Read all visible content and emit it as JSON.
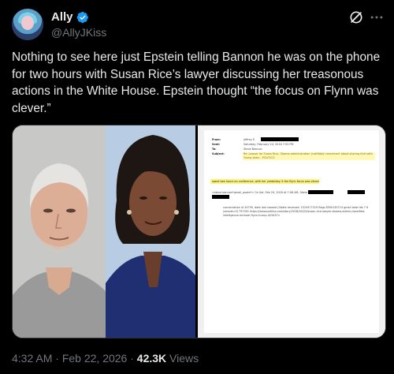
{
  "author": {
    "display_name": "Ally",
    "handle": "@AllyJKiss",
    "verified": true,
    "avatar_icon": "cartoon-avatar"
  },
  "header_icons": [
    "grok-icon",
    "more-options-icon"
  ],
  "tweet": {
    "text": "Nothing to see here just Epstein telling Bannon he was on the phone for two hours with Susan Rice’s lawyer discussing her treasonous actions in the White House. Epstein thought “the focus on Flynn was clever.”"
  },
  "media": {
    "images": [
      "photo-jeffrey-epstein",
      "photo-susan-rice",
      "email-document-screenshot"
    ],
    "document": {
      "from_label": "From:",
      "from_value": "jeffrey E.",
      "sent_label": "Sent:",
      "sent_value": "Saturday, February 24, 2018 7:53 PM",
      "to_label": "To:",
      "to_value": "Steve Bannon",
      "subject_label": "Subject:",
      "subject_value": "Re: Lawyer for Susan Rice, Obama administration 'justifiably concerned' about sharing intel with Trump team - POLITICO",
      "body_line": "spent two hours on conference, with her yesterday. it the flynn focus was clever",
      "quote_line": "<steve.bannon*gmail_quote*> On Sat, Feb 24, 2018 at 7:06 AM, Steve Bannon",
      "quote_tail": "wrote:",
      "footer_lines": [
        "conversation id 34799, date last viewed (Gdate received: 1519477319 flags 8590135715 gmail label ids 7 6",
        "(smode=0) 797001 https://www.politico.com/story/2018/02/23/susan-rice-lawyer-obama-admin-classified-",
        "intelligence-michael-flynn-trump-423437>"
      ]
    }
  },
  "meta": {
    "time": "4:32 AM",
    "separator": "·",
    "date": "Feb 22, 2026",
    "views_count": "42.3K",
    "views_label": "Views"
  },
  "colors": {
    "background": "#000000",
    "text_primary": "#e7e9ea",
    "text_secondary": "#71767b",
    "verified_blue": "#1d9bf0"
  }
}
